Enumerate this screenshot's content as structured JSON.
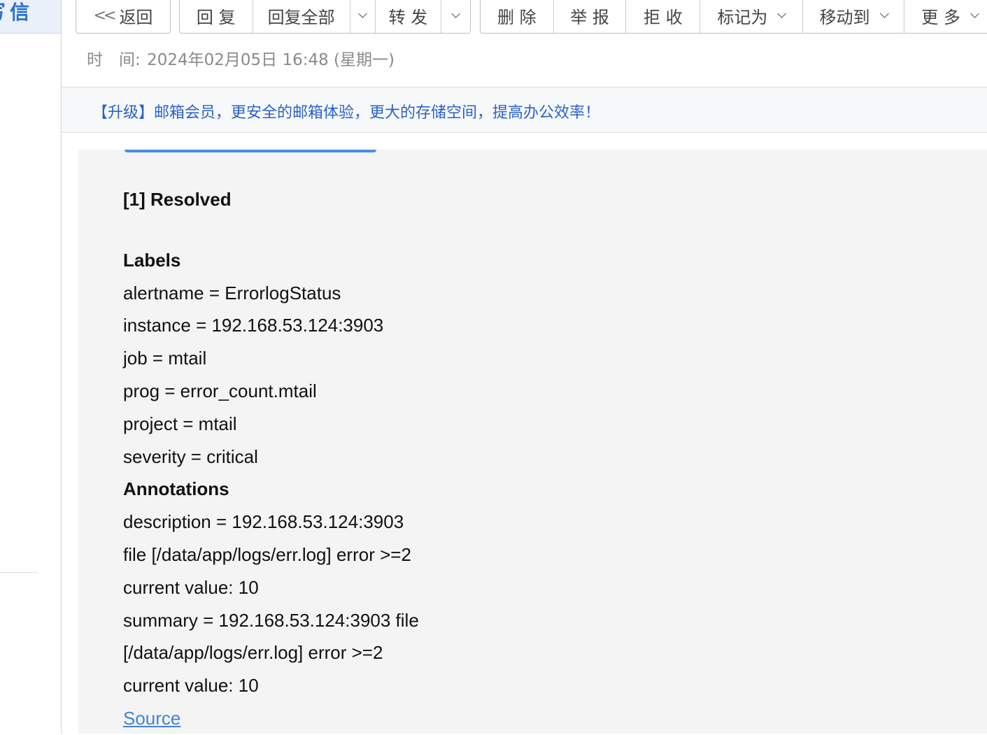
{
  "sidebar": {
    "write_label": "写信"
  },
  "toolbar": {
    "back": "返回",
    "reply": "回 复",
    "reply_all": "回复全部",
    "forward": "转 发",
    "delete": "删 除",
    "report": "举 报",
    "reject": "拒 收",
    "mark_as": "标记为",
    "move_to": "移动到",
    "more": "更 多"
  },
  "header": {
    "time_label": "时　间:",
    "time_value": "2024年02月05日 16:48 (星期一)"
  },
  "banner": {
    "text": "【升级】邮箱会员，更安全的邮箱体验，更大的存储空间，提高办公效率！"
  },
  "mail": {
    "status_title": "[1] Resolved",
    "labels_heading": "Labels",
    "labels": [
      "alertname = ErrorlogStatus",
      "instance = 192.168.53.124:3903",
      "job = mtail",
      "prog = error_count.mtail",
      "project = mtail",
      "severity = critical"
    ],
    "annotations_heading": "Annotations",
    "annotations": [
      "description = 192.168.53.124:3903",
      "file [/data/app/logs/err.log] error >=2",
      "current value: 10",
      "summary = 192.168.53.124:3903 file",
      "[/data/app/logs/err.log] error >=2",
      "current value: 10"
    ],
    "source_link": "Source"
  },
  "colors": {
    "accent": "#2d6fd2",
    "banner_link": "#2a62c9",
    "source_link": "#3f84d6",
    "body_bg": "#f4f4f4"
  }
}
